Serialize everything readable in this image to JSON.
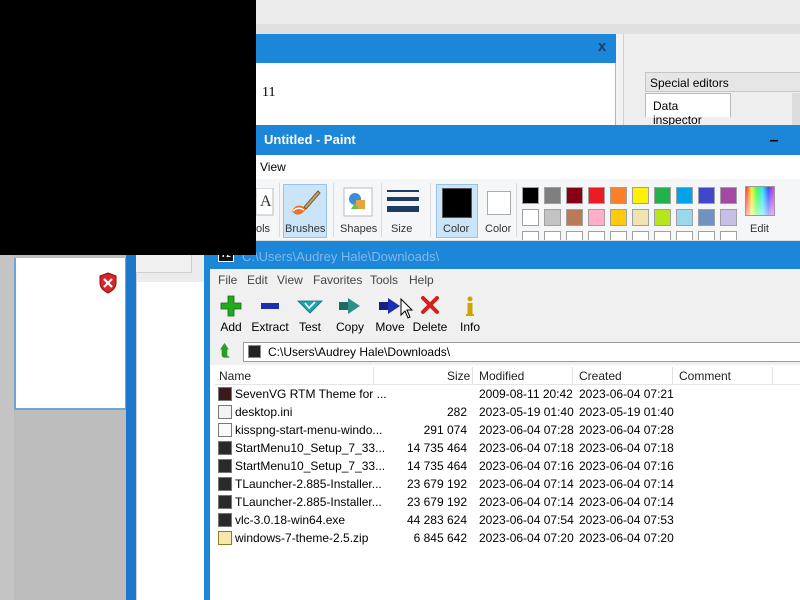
{
  "dialog": {
    "value": "11",
    "close_label": "x"
  },
  "right_panel": {
    "header": "Special editors",
    "tab": "Data inspector"
  },
  "paint": {
    "title": "Untitled - Paint",
    "menu": {
      "view": "View"
    },
    "ribbon": {
      "tools": "ols",
      "brushes": "Brushes",
      "shapes": "Shapes",
      "size": "Size",
      "color1": "Color",
      "color2": "Color",
      "edit_colors": "Edit"
    },
    "palette": {
      "row1": [
        "#000000",
        "#7f7f7f",
        "#880015",
        "#ed1c24",
        "#ff7f27",
        "#fff200",
        "#22b14c",
        "#00a2e8",
        "#3f48cc",
        "#a349a4"
      ],
      "row2": [
        "#ffffff",
        "#c3c3c3",
        "#b97a57",
        "#ffaec9",
        "#ffc90e",
        "#efe4b0",
        "#b5e61d",
        "#99d9ea",
        "#7092be",
        "#c8bfe7"
      ]
    },
    "minimize": "–"
  },
  "zip": {
    "title": "C:\\Users\\Audrey Hale\\Downloads\\",
    "menu": [
      "File",
      "Edit",
      "View",
      "Favorites",
      "Tools",
      "Help"
    ],
    "toolbar": [
      {
        "label": "Add",
        "icon": "plus-icon",
        "color": "#1faa1f"
      },
      {
        "label": "Extract",
        "icon": "minus-icon",
        "color": "#1d2fb0"
      },
      {
        "label": "Test",
        "icon": "check-icon",
        "color": "#1aa7b3"
      },
      {
        "label": "Copy",
        "icon": "copy-arrow-icon",
        "color": "#2c8f88"
      },
      {
        "label": "Move",
        "icon": "move-arrow-icon",
        "color": "#1d2fb0"
      },
      {
        "label": "Delete",
        "icon": "delete-x-icon",
        "color": "#d62020"
      },
      {
        "label": "Info",
        "icon": "info-icon",
        "color": "#c8a800"
      }
    ],
    "address": "C:\\Users\\Audrey Hale\\Downloads\\",
    "columns": {
      "name": "Name",
      "size": "Size",
      "modified": "Modified",
      "created": "Created",
      "comment": "Comment"
    },
    "files": [
      {
        "name": "SevenVG RTM Theme for ...",
        "size": "",
        "modified": "2009-08-11 20:42",
        "created": "2023-06-04 07:21",
        "icon": "folder-icon"
      },
      {
        "name": "desktop.ini",
        "size": "282",
        "modified": "2023-05-19 01:40",
        "created": "2023-05-19 01:40",
        "icon": "ini-file-icon"
      },
      {
        "name": "kisspng-start-menu-windo...",
        "size": "291 074",
        "modified": "2023-06-04 07:28",
        "created": "2023-06-04 07:28",
        "icon": "file-icon"
      },
      {
        "name": "StartMenu10_Setup_7_33...",
        "size": "14 735 464",
        "modified": "2023-06-04 07:18",
        "created": "2023-06-04 07:18",
        "icon": "exe-icon"
      },
      {
        "name": "StartMenu10_Setup_7_33...",
        "size": "14 735 464",
        "modified": "2023-06-04 07:16",
        "created": "2023-06-04 07:16",
        "icon": "exe-icon"
      },
      {
        "name": "TLauncher-2.885-Installer...",
        "size": "23 679 192",
        "modified": "2023-06-04 07:14",
        "created": "2023-06-04 07:14",
        "icon": "exe-icon"
      },
      {
        "name": "TLauncher-2.885-Installer...",
        "size": "23 679 192",
        "modified": "2023-06-04 07:14",
        "created": "2023-06-04 07:14",
        "icon": "exe-icon"
      },
      {
        "name": "vlc-3.0.18-win64.exe",
        "size": "44 283 624",
        "modified": "2023-06-04 07:54",
        "created": "2023-06-04 07:53",
        "icon": "exe-icon"
      },
      {
        "name": "windows-7-theme-2.5.zip",
        "size": "6 845 642",
        "modified": "2023-06-04 07:20",
        "created": "2023-06-04 07:20",
        "icon": "zip-icon"
      }
    ]
  },
  "colors": {
    "title_blue": "#1c86d9",
    "ribbon_selected": "#cce4f7"
  }
}
